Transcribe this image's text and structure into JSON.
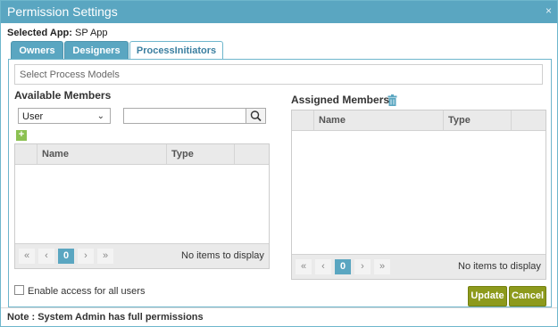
{
  "dialog": {
    "title": "Permission Settings",
    "close_icon": "×"
  },
  "selected_app": {
    "label": "Selected App:",
    "value": "SP App"
  },
  "tabs": [
    {
      "label": "Owners"
    },
    {
      "label": "Designers"
    },
    {
      "label": "ProcessInitiators",
      "active": true
    }
  ],
  "process_models": {
    "placeholder": "Select Process Models"
  },
  "available": {
    "title": "Available Members",
    "type_select": "User",
    "search_value": "",
    "columns": [
      "Name",
      "Type"
    ],
    "pager": {
      "first": "«",
      "prev": "‹",
      "page": "0",
      "next": "›",
      "last": "»",
      "status": "No items to display"
    }
  },
  "assigned": {
    "title": "Assigned Members",
    "columns": [
      "Name",
      "Type"
    ],
    "pager": {
      "first": "«",
      "prev": "‹",
      "page": "0",
      "next": "›",
      "last": "»",
      "status": "No items to display"
    }
  },
  "enable_all": {
    "label": "Enable access for all users"
  },
  "buttons": {
    "update": "Update",
    "cancel": "Cancel"
  },
  "note": "Note : System Admin has full permissions",
  "colors": {
    "accent": "#5aa6c1",
    "button": "#8d9a1c",
    "add": "#8cc152"
  }
}
